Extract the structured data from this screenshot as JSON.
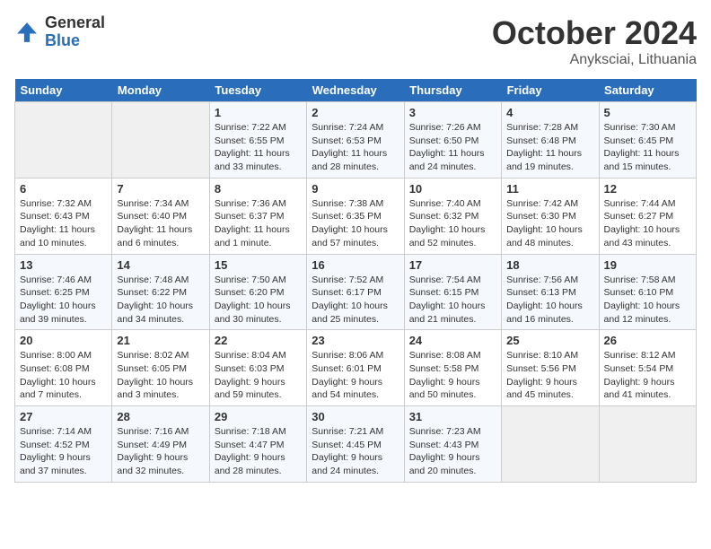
{
  "header": {
    "logo_general": "General",
    "logo_blue": "Blue",
    "month": "October 2024",
    "location": "Anyksciai, Lithuania"
  },
  "weekdays": [
    "Sunday",
    "Monday",
    "Tuesday",
    "Wednesday",
    "Thursday",
    "Friday",
    "Saturday"
  ],
  "weeks": [
    [
      {
        "day": "",
        "sunrise": "",
        "sunset": "",
        "daylight": ""
      },
      {
        "day": "",
        "sunrise": "",
        "sunset": "",
        "daylight": ""
      },
      {
        "day": "1",
        "sunrise": "Sunrise: 7:22 AM",
        "sunset": "Sunset: 6:55 PM",
        "daylight": "Daylight: 11 hours and 33 minutes."
      },
      {
        "day": "2",
        "sunrise": "Sunrise: 7:24 AM",
        "sunset": "Sunset: 6:53 PM",
        "daylight": "Daylight: 11 hours and 28 minutes."
      },
      {
        "day": "3",
        "sunrise": "Sunrise: 7:26 AM",
        "sunset": "Sunset: 6:50 PM",
        "daylight": "Daylight: 11 hours and 24 minutes."
      },
      {
        "day": "4",
        "sunrise": "Sunrise: 7:28 AM",
        "sunset": "Sunset: 6:48 PM",
        "daylight": "Daylight: 11 hours and 19 minutes."
      },
      {
        "day": "5",
        "sunrise": "Sunrise: 7:30 AM",
        "sunset": "Sunset: 6:45 PM",
        "daylight": "Daylight: 11 hours and 15 minutes."
      }
    ],
    [
      {
        "day": "6",
        "sunrise": "Sunrise: 7:32 AM",
        "sunset": "Sunset: 6:43 PM",
        "daylight": "Daylight: 11 hours and 10 minutes."
      },
      {
        "day": "7",
        "sunrise": "Sunrise: 7:34 AM",
        "sunset": "Sunset: 6:40 PM",
        "daylight": "Daylight: 11 hours and 6 minutes."
      },
      {
        "day": "8",
        "sunrise": "Sunrise: 7:36 AM",
        "sunset": "Sunset: 6:37 PM",
        "daylight": "Daylight: 11 hours and 1 minute."
      },
      {
        "day": "9",
        "sunrise": "Sunrise: 7:38 AM",
        "sunset": "Sunset: 6:35 PM",
        "daylight": "Daylight: 10 hours and 57 minutes."
      },
      {
        "day": "10",
        "sunrise": "Sunrise: 7:40 AM",
        "sunset": "Sunset: 6:32 PM",
        "daylight": "Daylight: 10 hours and 52 minutes."
      },
      {
        "day": "11",
        "sunrise": "Sunrise: 7:42 AM",
        "sunset": "Sunset: 6:30 PM",
        "daylight": "Daylight: 10 hours and 48 minutes."
      },
      {
        "day": "12",
        "sunrise": "Sunrise: 7:44 AM",
        "sunset": "Sunset: 6:27 PM",
        "daylight": "Daylight: 10 hours and 43 minutes."
      }
    ],
    [
      {
        "day": "13",
        "sunrise": "Sunrise: 7:46 AM",
        "sunset": "Sunset: 6:25 PM",
        "daylight": "Daylight: 10 hours and 39 minutes."
      },
      {
        "day": "14",
        "sunrise": "Sunrise: 7:48 AM",
        "sunset": "Sunset: 6:22 PM",
        "daylight": "Daylight: 10 hours and 34 minutes."
      },
      {
        "day": "15",
        "sunrise": "Sunrise: 7:50 AM",
        "sunset": "Sunset: 6:20 PM",
        "daylight": "Daylight: 10 hours and 30 minutes."
      },
      {
        "day": "16",
        "sunrise": "Sunrise: 7:52 AM",
        "sunset": "Sunset: 6:17 PM",
        "daylight": "Daylight: 10 hours and 25 minutes."
      },
      {
        "day": "17",
        "sunrise": "Sunrise: 7:54 AM",
        "sunset": "Sunset: 6:15 PM",
        "daylight": "Daylight: 10 hours and 21 minutes."
      },
      {
        "day": "18",
        "sunrise": "Sunrise: 7:56 AM",
        "sunset": "Sunset: 6:13 PM",
        "daylight": "Daylight: 10 hours and 16 minutes."
      },
      {
        "day": "19",
        "sunrise": "Sunrise: 7:58 AM",
        "sunset": "Sunset: 6:10 PM",
        "daylight": "Daylight: 10 hours and 12 minutes."
      }
    ],
    [
      {
        "day": "20",
        "sunrise": "Sunrise: 8:00 AM",
        "sunset": "Sunset: 6:08 PM",
        "daylight": "Daylight: 10 hours and 7 minutes."
      },
      {
        "day": "21",
        "sunrise": "Sunrise: 8:02 AM",
        "sunset": "Sunset: 6:05 PM",
        "daylight": "Daylight: 10 hours and 3 minutes."
      },
      {
        "day": "22",
        "sunrise": "Sunrise: 8:04 AM",
        "sunset": "Sunset: 6:03 PM",
        "daylight": "Daylight: 9 hours and 59 minutes."
      },
      {
        "day": "23",
        "sunrise": "Sunrise: 8:06 AM",
        "sunset": "Sunset: 6:01 PM",
        "daylight": "Daylight: 9 hours and 54 minutes."
      },
      {
        "day": "24",
        "sunrise": "Sunrise: 8:08 AM",
        "sunset": "Sunset: 5:58 PM",
        "daylight": "Daylight: 9 hours and 50 minutes."
      },
      {
        "day": "25",
        "sunrise": "Sunrise: 8:10 AM",
        "sunset": "Sunset: 5:56 PM",
        "daylight": "Daylight: 9 hours and 45 minutes."
      },
      {
        "day": "26",
        "sunrise": "Sunrise: 8:12 AM",
        "sunset": "Sunset: 5:54 PM",
        "daylight": "Daylight: 9 hours and 41 minutes."
      }
    ],
    [
      {
        "day": "27",
        "sunrise": "Sunrise: 7:14 AM",
        "sunset": "Sunset: 4:52 PM",
        "daylight": "Daylight: 9 hours and 37 minutes."
      },
      {
        "day": "28",
        "sunrise": "Sunrise: 7:16 AM",
        "sunset": "Sunset: 4:49 PM",
        "daylight": "Daylight: 9 hours and 32 minutes."
      },
      {
        "day": "29",
        "sunrise": "Sunrise: 7:18 AM",
        "sunset": "Sunset: 4:47 PM",
        "daylight": "Daylight: 9 hours and 28 minutes."
      },
      {
        "day": "30",
        "sunrise": "Sunrise: 7:21 AM",
        "sunset": "Sunset: 4:45 PM",
        "daylight": "Daylight: 9 hours and 24 minutes."
      },
      {
        "day": "31",
        "sunrise": "Sunrise: 7:23 AM",
        "sunset": "Sunset: 4:43 PM",
        "daylight": "Daylight: 9 hours and 20 minutes."
      },
      {
        "day": "",
        "sunrise": "",
        "sunset": "",
        "daylight": ""
      },
      {
        "day": "",
        "sunrise": "",
        "sunset": "",
        "daylight": ""
      }
    ]
  ]
}
